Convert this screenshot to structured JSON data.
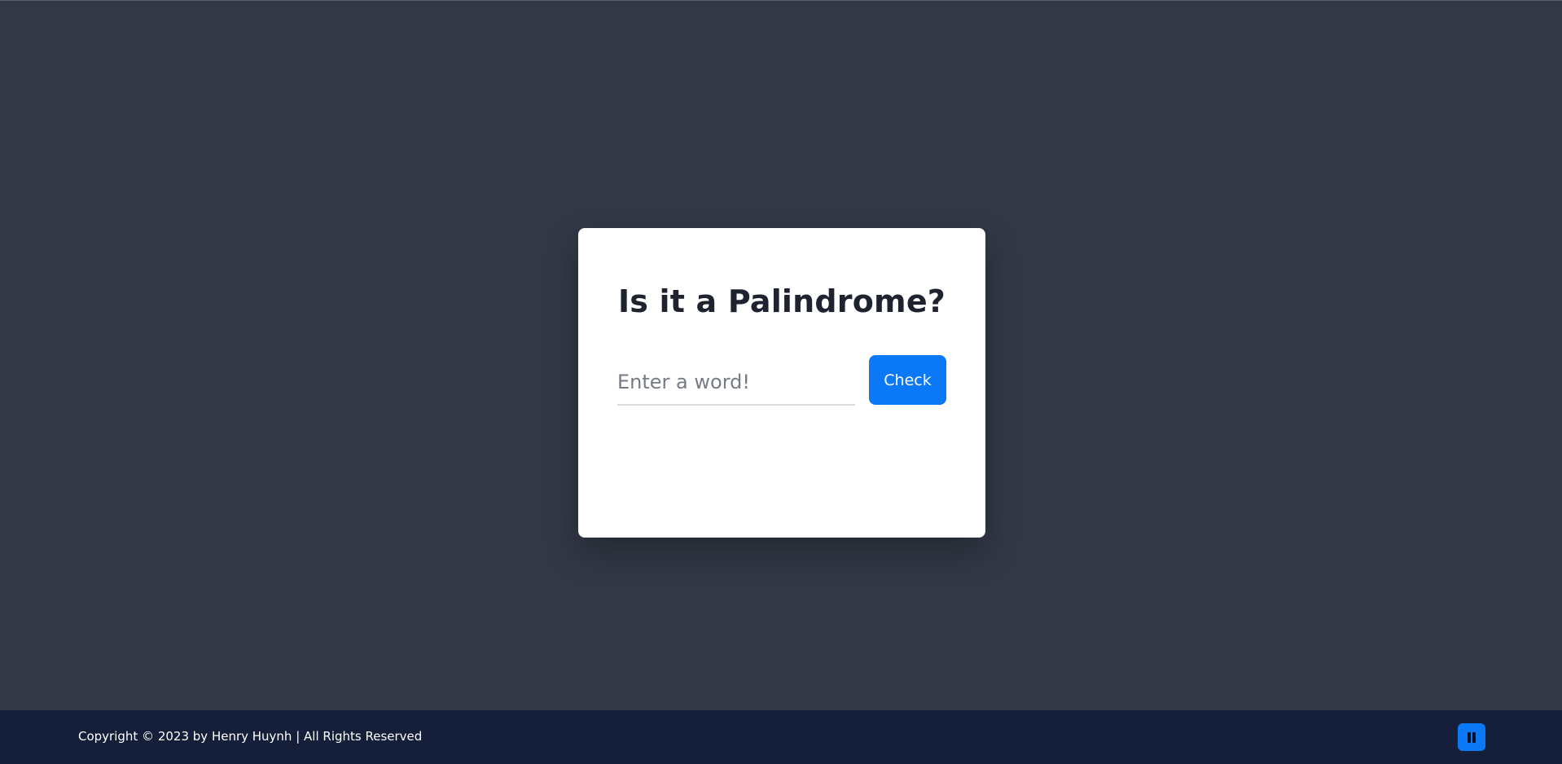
{
  "card": {
    "title": "Is it a Palindrome?",
    "input_placeholder": "Enter a word!",
    "input_value": "",
    "check_label": "Check"
  },
  "footer": {
    "copyright": "Copyright © 2023 by Henry Huynh | All Rights Reserved",
    "pause_icon": "pause-icon"
  },
  "colors": {
    "background": "#333846",
    "card": "#ffffff",
    "accent": "#0b78f5",
    "footer": "#161f3a",
    "title": "#1f2330"
  }
}
